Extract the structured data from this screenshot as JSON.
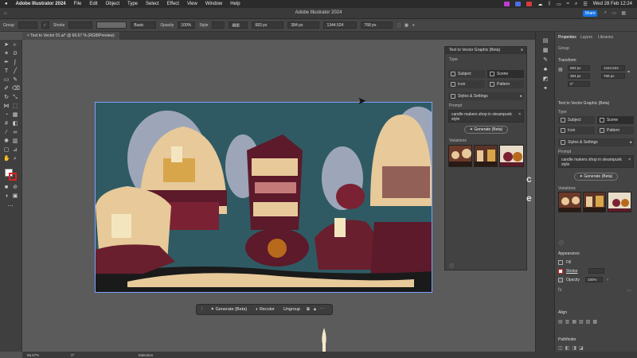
{
  "menubar": {
    "app_name": "Adobe Illustrator 2024",
    "items": [
      "File",
      "Edit",
      "Object",
      "Type",
      "Select",
      "Effect",
      "View",
      "Window",
      "Help"
    ],
    "clock": "Wed 28 Feb  12:24"
  },
  "window": {
    "title": "Adobe Illustrator 2024",
    "share_label": "Share"
  },
  "control_bar": {
    "selection_label": "Group",
    "stroke_label": "Stroke",
    "brush_label": "Basic",
    "opacity_label": "Opacity",
    "opacity_value": "100%",
    "style_label": "Style",
    "x_value": "683 px",
    "y_value": "384 px",
    "w_value": "1344.524",
    "h_value": "768 px"
  },
  "document_tab": {
    "label": "Text to Vector 01.ai* @ 66.67 % (RGB/Preview)"
  },
  "floating_panel": {
    "title": "Text to Vector Graphic (Beta)",
    "type_label": "Type",
    "type_options": [
      "Subject",
      "Scene",
      "Icon",
      "Pattern"
    ],
    "selected_type": "Scene",
    "styles_label": "Styles & Settings",
    "prompt_label": "Prompt",
    "prompt_text": "candle makers shop in steampunk style",
    "generate_label": "Generate (Beta)",
    "variations_label": "Variations"
  },
  "context_bar": {
    "generate_label": "Generate (Beta)",
    "recolor_label": "Recolor",
    "ungroup_label": "Ungroup"
  },
  "properties_panel": {
    "tabs": [
      "Properties",
      "Layers",
      "Libraries"
    ],
    "selection_label": "Group",
    "transform_label": "Transform",
    "x_value": "683 px",
    "y_value": "384 px",
    "w_value": "1344.524",
    "h_value": "768 px",
    "angle_value": "0°",
    "t2v_title": "Text to Vector Graphic (Beta)",
    "type_label": "Type",
    "type_options": [
      "Subject",
      "Scene",
      "Icon",
      "Pattern"
    ],
    "styles_label": "Styles & Settings",
    "prompt_label": "Prompt",
    "prompt_text": "candle makers shop in steampunk style",
    "generate_label": "Generate (Beta)",
    "variations_label": "Variations",
    "appearance_label": "Appearance",
    "fill_label": "Fill",
    "stroke_label": "Stroke",
    "opacity_label": "Opacity",
    "opacity_value": "100%",
    "align_label": "Align",
    "pathfinder_label": "Pathfinder"
  },
  "status_bar": {
    "zoom": "66.67%",
    "angle": "0°",
    "tool": "Selection"
  },
  "colors": {
    "accent": "#1473e6",
    "art_teal": "#2f5a63",
    "art_maroon": "#5c1a2b",
    "art_cream": "#e7c99a",
    "art_mauve": "#9da6b8"
  }
}
